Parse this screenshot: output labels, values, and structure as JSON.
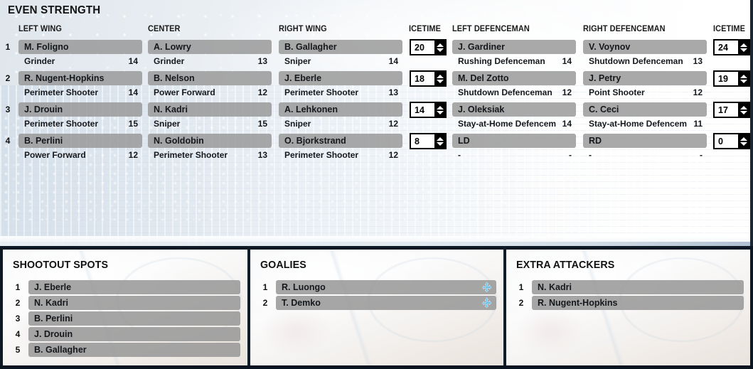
{
  "even_strength": {
    "title": "EVEN STRENGTH",
    "headers": {
      "left_wing": "LEFT WING",
      "center": "CENTER",
      "right_wing": "RIGHT WING",
      "icetime_forwards": "ICETIME",
      "left_defenceman": "LEFT DEFENCEMAN",
      "right_defenceman": "RIGHT DEFENCEMAN",
      "icetime_defence": "ICETIME"
    },
    "forward_lines": [
      {
        "number": "1",
        "icetime": "20",
        "left_wing": {
          "name": "M. Foligno",
          "trait": "Grinder",
          "rating": "14"
        },
        "center": {
          "name": "A. Lowry",
          "trait": "Grinder",
          "rating": "13"
        },
        "right_wing": {
          "name": "B. Gallagher",
          "trait": "Sniper",
          "rating": "14"
        }
      },
      {
        "number": "2",
        "icetime": "18",
        "left_wing": {
          "name": "R. Nugent-Hopkins",
          "trait": "Perimeter Shooter",
          "rating": "14"
        },
        "center": {
          "name": "B. Nelson",
          "trait": "Power Forward",
          "rating": "12"
        },
        "right_wing": {
          "name": "J. Eberle",
          "trait": "Perimeter Shooter",
          "rating": "13"
        }
      },
      {
        "number": "3",
        "icetime": "14",
        "left_wing": {
          "name": "J. Drouin",
          "trait": "Perimeter Shooter",
          "rating": "15"
        },
        "center": {
          "name": "N. Kadri",
          "trait": "Sniper",
          "rating": "15"
        },
        "right_wing": {
          "name": "A. Lehkonen",
          "trait": "Sniper",
          "rating": "12"
        }
      },
      {
        "number": "4",
        "icetime": "8",
        "left_wing": {
          "name": "B. Perlini",
          "trait": "Power Forward",
          "rating": "12"
        },
        "center": {
          "name": "N. Goldobin",
          "trait": "Perimeter Shooter",
          "rating": "13"
        },
        "right_wing": {
          "name": "O. Bjorkstrand",
          "trait": "Perimeter Shooter",
          "rating": "12"
        }
      }
    ],
    "defence_pairs": [
      {
        "number": "1",
        "icetime": "24",
        "left_defenceman": {
          "name": "J. Gardiner",
          "trait": "Rushing Defenceman",
          "rating": "14"
        },
        "right_defenceman": {
          "name": "V. Voynov",
          "trait": "Shutdown Defenceman",
          "rating": "13"
        }
      },
      {
        "number": "2",
        "icetime": "19",
        "left_defenceman": {
          "name": "M. Del Zotto",
          "trait": "Shutdown Defenceman",
          "rating": "12"
        },
        "right_defenceman": {
          "name": "J. Petry",
          "trait": "Point Shooter",
          "rating": "12"
        }
      },
      {
        "number": "3",
        "icetime": "17",
        "left_defenceman": {
          "name": "J. Oleksiak",
          "trait": "Stay-at-Home Defencem",
          "rating": "14"
        },
        "right_defenceman": {
          "name": "C. Ceci",
          "trait": "Stay-at-Home Defencem",
          "rating": "11"
        }
      },
      {
        "number": "4",
        "icetime": "0",
        "left_defenceman": {
          "name": "LD",
          "trait": "-",
          "rating": "-"
        },
        "right_defenceman": {
          "name": "RD",
          "trait": "-",
          "rating": "-"
        }
      }
    ]
  },
  "shootout_spots": {
    "title": "SHOOTOUT SPOTS",
    "players": [
      {
        "number": "1",
        "name": "J. Eberle"
      },
      {
        "number": "2",
        "name": "N. Kadri"
      },
      {
        "number": "3",
        "name": "B. Perlini"
      },
      {
        "number": "4",
        "name": "J. Drouin"
      },
      {
        "number": "5",
        "name": "B. Gallagher"
      }
    ]
  },
  "goalies": {
    "title": "GOALIES",
    "players": [
      {
        "number": "1",
        "name": "R. Luongo",
        "icon": "move-arrows-icon"
      },
      {
        "number": "2",
        "name": "T. Demko",
        "icon": "move-arrows-icon"
      }
    ]
  },
  "extra_attackers": {
    "title": "EXTRA ATTACKERS",
    "players": [
      {
        "number": "1",
        "name": "N. Kadri"
      },
      {
        "number": "2",
        "name": "R. Nugent-Hopkins"
      }
    ]
  },
  "colors": {
    "name_bar": "#969696",
    "spinner_border": "#000000",
    "move_icon": "#6fc0e8",
    "panel_separator": "#101c27"
  }
}
